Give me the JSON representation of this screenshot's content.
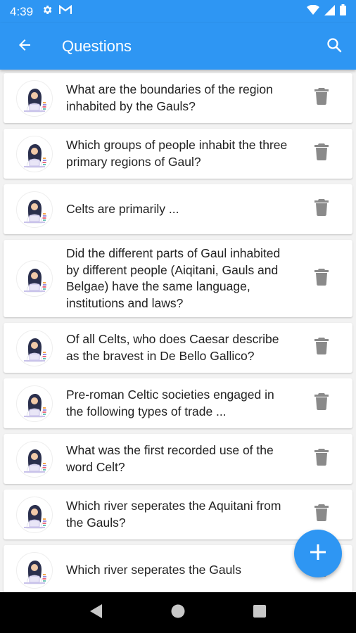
{
  "status_bar": {
    "time": "4:39",
    "icons": [
      "gear-icon",
      "gmail-icon",
      "wifi-icon",
      "signal-icon",
      "battery-icon"
    ]
  },
  "app_bar": {
    "title": "Questions",
    "back_icon": "arrow-left-icon",
    "search_icon": "search-icon"
  },
  "colors": {
    "primary": "#2e96f3",
    "delete_icon": "#8a8a8a",
    "text": "#222222"
  },
  "questions": [
    {
      "text": "What are the boundaries of the region inhabited by the Gauls?"
    },
    {
      "text": "Which groups of people inhabit the three primary regions of Gaul?"
    },
    {
      "text": "Celts are primarily ..."
    },
    {
      "text": "Did the different parts of Gaul inhabited by different people (Aiqitani, Gauls and Belgae) have the same language, institutions and laws?"
    },
    {
      "text": "Of all Celts, who does Caesar describe as the bravest in De Bello Gallico?"
    },
    {
      "text": "Pre-roman Celtic societies engaged in the following types of trade ..."
    },
    {
      "text": "What was the first recorded use of the word Celt?"
    },
    {
      "text": "Which river seperates the Aquitani from the Gauls?"
    },
    {
      "text": "Which river seperates the Gauls"
    }
  ],
  "fab": {
    "icon": "plus-icon"
  },
  "nav_bar": {
    "icons": [
      "back-triangle-icon",
      "home-circle-icon",
      "recents-square-icon"
    ]
  }
}
